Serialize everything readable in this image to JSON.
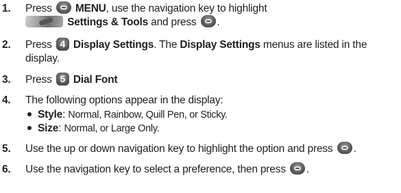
{
  "steps": [
    {
      "num": "1.",
      "line1_pre": "Press",
      "menu_label": "MENU",
      "line1_post": ", use the navigation key to highlight",
      "settings_label": "Settings & Tools",
      "line2_post": "and press",
      "line2_end": "."
    },
    {
      "num": "2.",
      "pre": "Press",
      "key_number": "4",
      "label": "Display Settings",
      "mid": ". The",
      "label2": "Display Settings",
      "post": "menus are listed in the",
      "line2": "display."
    },
    {
      "num": "3.",
      "pre": "Press",
      "key_number": "5",
      "label": "Dial Font",
      "post": "."
    },
    {
      "num": "4.",
      "text": "The following options appear in the display:"
    },
    {
      "num": "5.",
      "text": "Use the up or down navigation key to highlight the option and press",
      "end": "."
    },
    {
      "num": "6.",
      "text": "Use the navigation key to select a preference, then press",
      "end": "."
    }
  ],
  "options": [
    {
      "label": "Style",
      "sep": ":",
      "values": "Normal, Rainbow, Quill Pen, or Sticky."
    },
    {
      "label": "Size",
      "sep": ":",
      "values": "Normal, or Large Only."
    }
  ],
  "icons": {
    "menu_ok_key": "menu-ok-key-icon",
    "settings_tools": "settings-tools-icon",
    "key4": "number-4-key-icon",
    "key5": "number-5-key-icon"
  }
}
